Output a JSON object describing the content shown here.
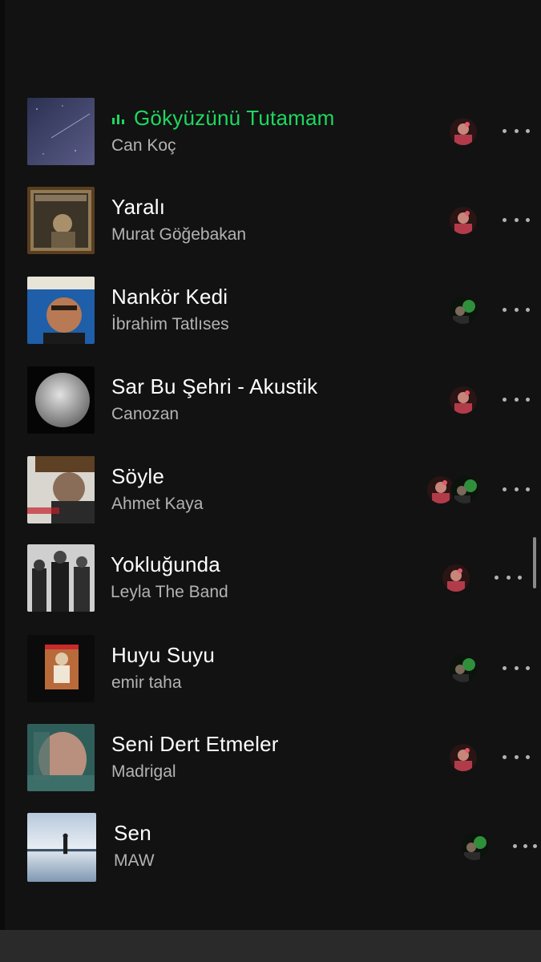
{
  "playlist": {
    "tracks": [
      {
        "title": "Gökyüzünü Tutamam",
        "artist": "Can Koç",
        "playing": true,
        "cover": "night-sky-cover",
        "added_by": [
          "avatar-red"
        ]
      },
      {
        "title": "Yaralı",
        "artist": "Murat Göğebakan",
        "playing": false,
        "cover": "murat-gogebakan-cover",
        "added_by": [
          "avatar-red"
        ]
      },
      {
        "title": "Nankör Kedi",
        "artist": "İbrahim Tatlıses",
        "playing": false,
        "cover": "ibrahim-tatlises-cover",
        "added_by": [
          "avatar-green"
        ]
      },
      {
        "title": "Sar Bu Şehri - Akustik",
        "artist": "Canozan",
        "playing": false,
        "cover": "moon-cover",
        "added_by": [
          "avatar-red"
        ]
      },
      {
        "title": "Söyle",
        "artist": "Ahmet Kaya",
        "playing": false,
        "cover": "ahmet-kaya-cover",
        "added_by": [
          "avatar-red",
          "avatar-green"
        ]
      },
      {
        "title": "Yokluğunda",
        "artist": "Leyla The Band",
        "playing": false,
        "cover": "leyla-the-band-cover",
        "added_by": [
          "avatar-red"
        ]
      },
      {
        "title": "Huyu Suyu",
        "artist": "emir taha",
        "playing": false,
        "cover": "emir-taha-cover",
        "added_by": [
          "avatar-green"
        ]
      },
      {
        "title": "Seni Dert Etmeler",
        "artist": "Madrigal",
        "playing": false,
        "cover": "madrigal-cover",
        "added_by": [
          "avatar-red"
        ]
      },
      {
        "title": "Sen",
        "artist": "MAW",
        "playing": false,
        "cover": "lake-cover",
        "added_by": [
          "avatar-green"
        ]
      }
    ]
  },
  "icons": {
    "now_playing": "equalizer-icon",
    "more": "more-options-icon"
  },
  "colors": {
    "background": "#121212",
    "accent": "#1ed760",
    "title": "#ffffff",
    "subtitle": "#b3b3b3"
  }
}
